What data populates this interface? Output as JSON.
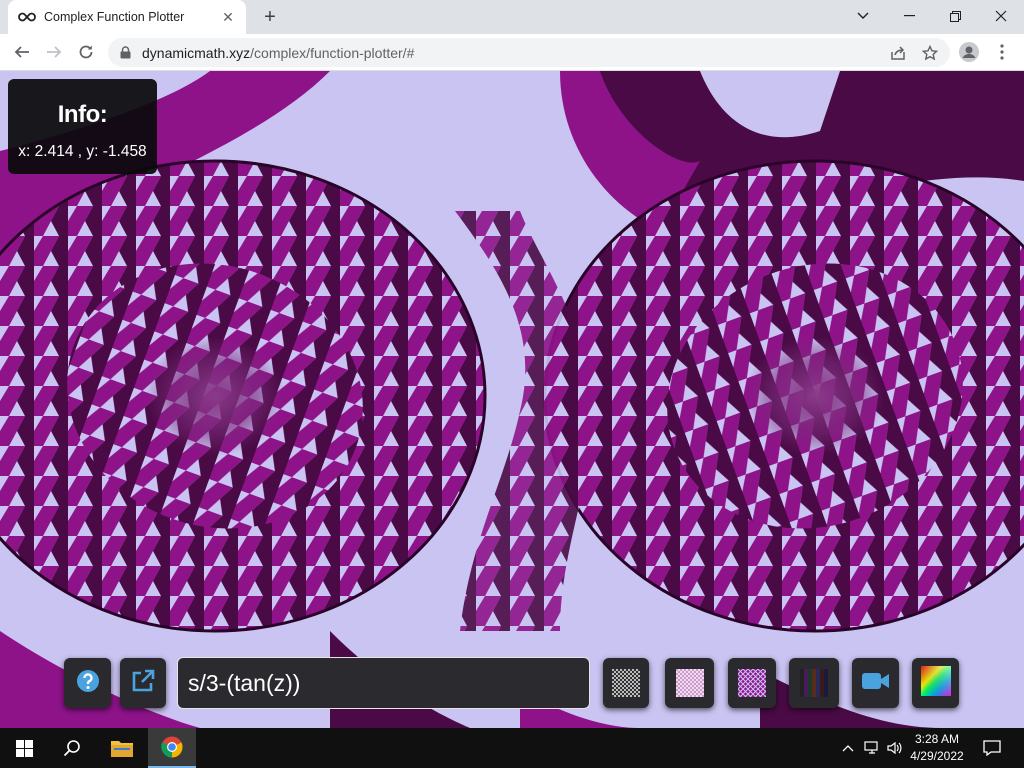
{
  "browser": {
    "tab_title": "Complex Function Plotter",
    "tab_icon": "infinity-icon",
    "url_host": "dynamicmath.xyz",
    "url_path": "/complex/function-plotter/#"
  },
  "page": {
    "info_title": "Info:",
    "coords": "x: 2.414 , y: -1.458",
    "function_value": "s/3-(tan(z))",
    "buttons": [
      "help-icon",
      "external-link-icon",
      "texture-checker-gray",
      "texture-checker-pink",
      "texture-checker-purple",
      "texture-color-bars",
      "video-camera-icon",
      "color-wheel-icon"
    ]
  },
  "colors": {
    "plot_light": "#c9c4f2",
    "plot_magenta": "#8e1389",
    "plot_dark": "#4a0a45",
    "info_bg": "#0a0a0c"
  },
  "taskbar": {
    "time": "3:28 AM",
    "date": "4/29/2022"
  }
}
